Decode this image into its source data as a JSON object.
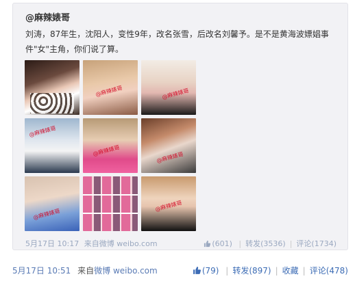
{
  "quoted_post": {
    "author": "@麻辣婊哥",
    "text": "刘涛，87年生，沈阳人，变性9年，改名张雪，后改名刘馨予。是不是黄海波嫖娼事件\"女\"主角，你们说了算。",
    "watermark": "@麻辣婊哥",
    "meta": {
      "time": "5月17日 10:17",
      "from_label": "来自",
      "source": "微博 weibo.com",
      "like_count": "(601)",
      "repost_label": "转发(3536)",
      "comment_label": "评论(1734)"
    }
  },
  "post_meta": {
    "time": "5月17日 10:51",
    "from_label": "来自",
    "source": "微博 weibo.com",
    "like_count": "(79)",
    "repost_label": "转发(897)",
    "favorite_label": "收藏",
    "comment_label": "评论(478)"
  },
  "colors": {
    "link": "#3c6cb5",
    "muted_link": "#9aa8c0",
    "quote_bg": "#f2f2f5"
  },
  "icons": {
    "like": "thumbs-up-icon"
  }
}
